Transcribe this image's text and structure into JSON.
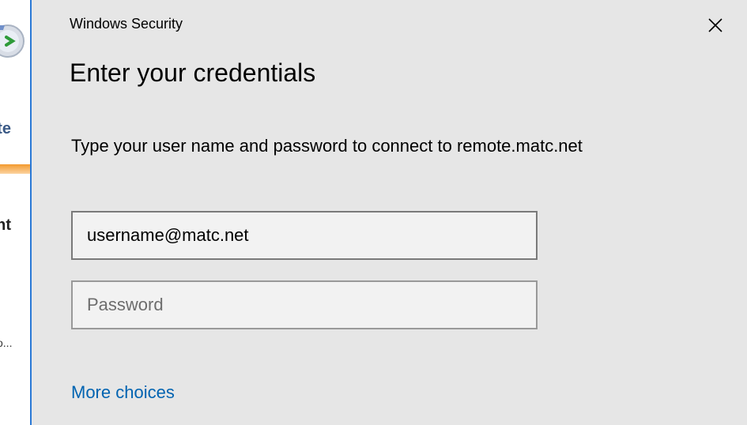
{
  "background_window": {
    "fragments": [
      "ote",
      "ent",
      ")",
      "o..."
    ]
  },
  "dialog": {
    "title": "Windows Security",
    "heading": "Enter your credentials",
    "description": "Type your user name and password to connect to remote.matc.net",
    "username": {
      "value": "username@matc.net"
    },
    "password": {
      "value": "",
      "placeholder": "Password"
    },
    "more_choices_label": "More choices",
    "close_icon": "close-icon"
  },
  "colors": {
    "dialog_background": "#e6e6e6",
    "accent_border": "#2b79d6",
    "link": "#0063b1"
  }
}
